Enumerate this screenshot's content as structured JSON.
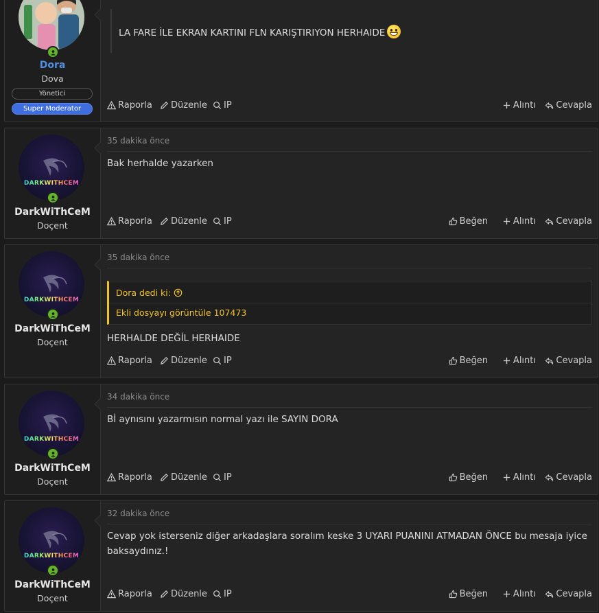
{
  "actions": {
    "report": "Raporla",
    "edit": "Düzenle",
    "ip": "IP",
    "like": "Beğen",
    "quote": "Alıntı",
    "reply": "Cevapla"
  },
  "colors": {
    "staff_name": "#4f8fe0",
    "online": "#63b32c",
    "quote_accent": "#f1c22e",
    "badge_super_moderator": "#3f6ee0"
  },
  "posts": [
    {
      "author": "Dora",
      "user_title": "Dova",
      "badges": [
        "Yönetici",
        "Super Moderator"
      ],
      "avatar_icon": "family-photo-avatar",
      "message": "LA FARE İLE EKRAN KARTINI FLN KARIŞTIRIYON HERHAIDE",
      "emoji": "grinning-face-emoji"
    },
    {
      "author": "DarkWiThCeM",
      "user_title": "Doçent",
      "avatar_text": "DARKWITHCEM",
      "time": "35 dakika önce",
      "message": "Bak herhalde yazarken"
    },
    {
      "author": "DarkWiThCeM",
      "user_title": "Doçent",
      "avatar_text": "DARKWITHCEM",
      "time": "35 dakika önce",
      "quote_author": "Dora dedi ki:",
      "quote_body": "Ekli dosyayı görüntüle 107473",
      "message": "HERHALDE DEĞİL HERHAIDE"
    },
    {
      "author": "DarkWiThCeM",
      "user_title": "Doçent",
      "avatar_text": "DARKWITHCEM",
      "time": "34 dakika önce",
      "message": "Bİ aynısını yazarmısın normal yazı ile SAYIN DORA"
    },
    {
      "author": "DarkWiThCeM",
      "user_title": "Doçent",
      "avatar_text": "DARKWITHCEM",
      "time": "32 dakika önce",
      "message": "Cevap yok isterseniz diğer arkadaşlara soralım keske 3 UYARI PUANINI ATMADAN ÖNCE bu mesaja iyice baksaydınız.!"
    }
  ]
}
